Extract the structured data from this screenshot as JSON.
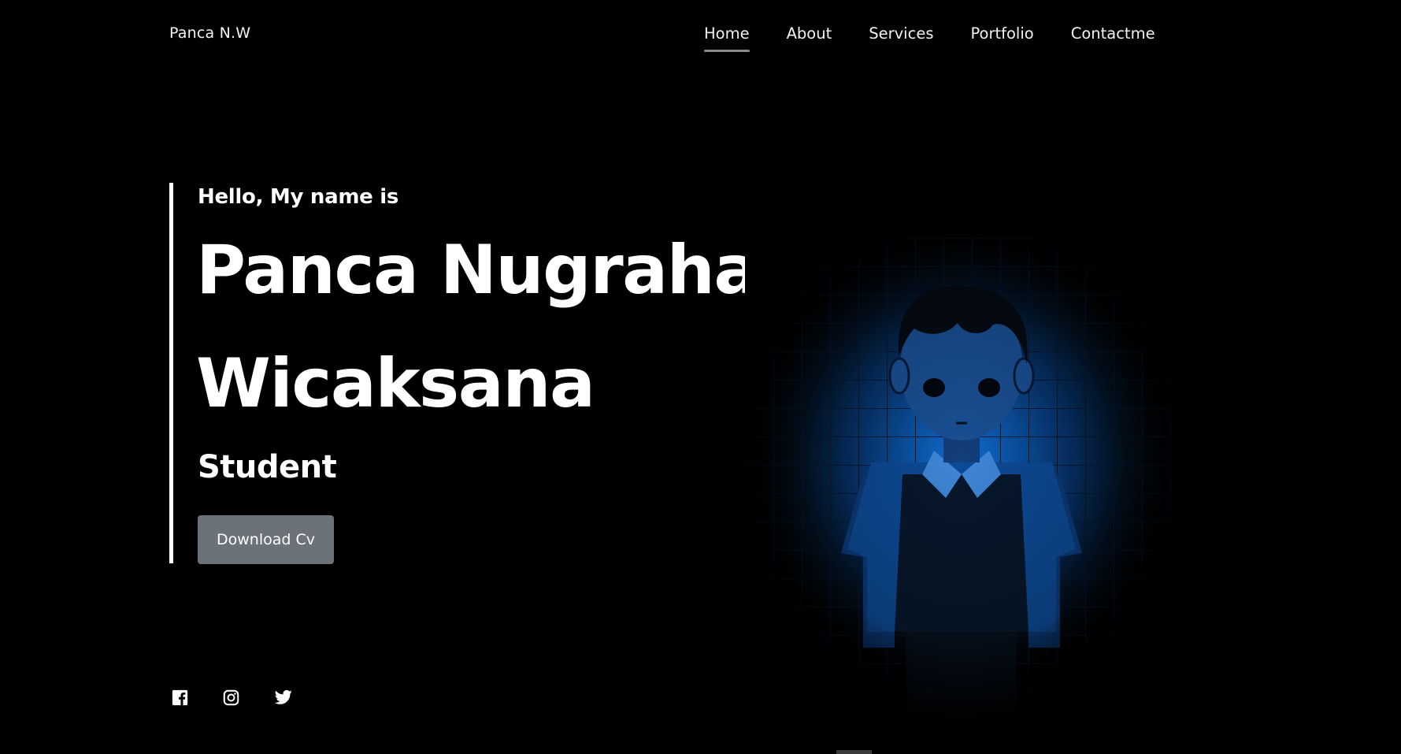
{
  "header": {
    "logo": "Panca N.W",
    "nav": [
      {
        "label": "Home",
        "active": true
      },
      {
        "label": "About",
        "active": false
      },
      {
        "label": "Services",
        "active": false
      },
      {
        "label": "Portfolio",
        "active": false
      },
      {
        "label": "Contactme",
        "active": false
      }
    ]
  },
  "hero": {
    "greeting": "Hello, My name is",
    "name_line1": "Panca Nugraha",
    "name_line2": "Wicaksana",
    "role": "Student",
    "cta_label": "Download Cv"
  },
  "social": {
    "icons": [
      "facebook-icon",
      "instagram-icon",
      "twitter-icon"
    ]
  },
  "colors": {
    "background": "#000000",
    "text": "#ffffff",
    "button": "#6c727a",
    "nav_underline": "#8a8a8a",
    "illustration_glow": "#0f6fd6"
  }
}
